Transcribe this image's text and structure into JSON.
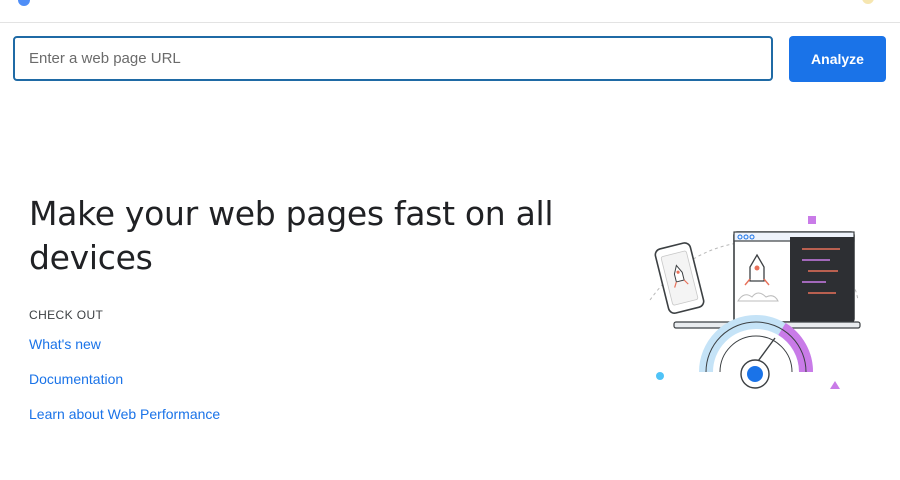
{
  "search": {
    "placeholder": "Enter a web page URL",
    "value": ""
  },
  "toolbar": {
    "analyze_label": "Analyze"
  },
  "hero": {
    "headline": "Make your web pages fast on all devices",
    "check_out_label": "CHECK OUT",
    "links": [
      {
        "label": "What's new"
      },
      {
        "label": "Documentation"
      },
      {
        "label": "Learn about Web Performance"
      }
    ],
    "illustration_icon": "rocket-speed-illustration"
  },
  "colors": {
    "accent": "#1a73e8",
    "input_border": "#1f6aa5",
    "text": "#202124"
  }
}
